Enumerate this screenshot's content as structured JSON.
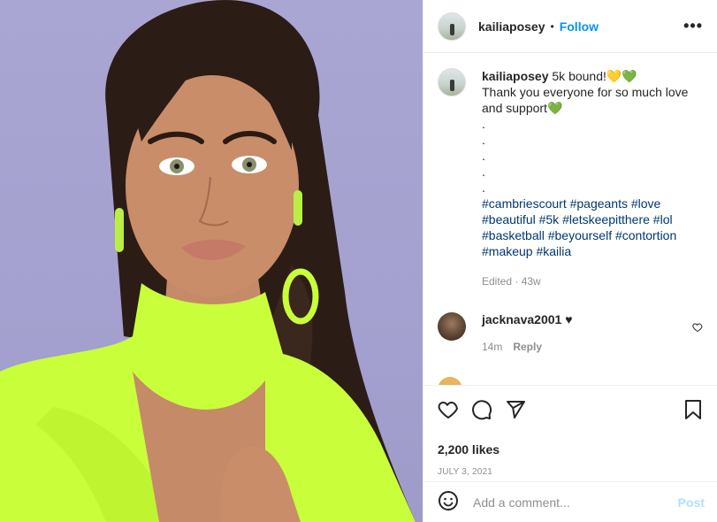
{
  "post": {
    "image_alt": "Portrait photo",
    "username": "kailiaposey",
    "follow_label": "Follow",
    "more_label": "•••",
    "caption": {
      "line1": "5k bound!💛💚",
      "line2": "Thank you everyone for so much love and support💚",
      "dots": [
        ".",
        ".",
        ".",
        ".",
        "."
      ],
      "hashtags": "#cambriescourt #pageants #love #beautiful #5k #letskeepitthere #lol #basketball #beyourself #contortion #makeup #kailia",
      "edited": "Edited · 43w"
    },
    "comments": [
      {
        "username": "jacknava2001",
        "text": "♥",
        "time": "14m",
        "reply_label": "Reply"
      }
    ],
    "likes": "2,200 likes",
    "date": "JULY 3, 2021",
    "add_comment_placeholder": "Add a comment...",
    "post_label": "Post"
  },
  "icons": {
    "like": "heart-icon",
    "comment": "comment-icon",
    "share": "share-icon",
    "save": "bookmark-icon",
    "emoji": "emoji-icon",
    "comment_like": "small-heart-icon"
  },
  "colors": {
    "link": "#0095f6",
    "hashtag": "#00376b",
    "muted": "#8e8e8e",
    "shirt": "#c8ff3a"
  }
}
